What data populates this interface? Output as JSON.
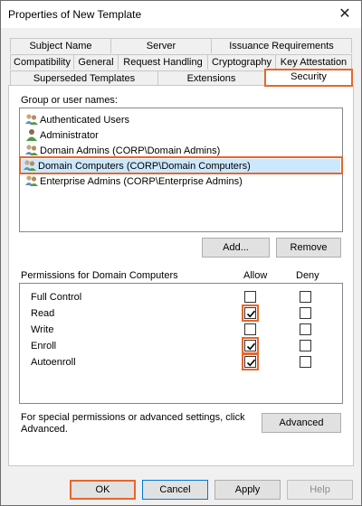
{
  "window": {
    "title": "Properties of New Template",
    "close_glyph": "✕"
  },
  "tabs": {
    "row1": [
      "Subject Name",
      "Server",
      "Issuance Requirements"
    ],
    "row2": [
      "Compatibility",
      "General",
      "Request Handling",
      "Cryptography",
      "Key Attestation"
    ],
    "row3": [
      "Superseded Templates",
      "Extensions",
      "Security"
    ],
    "active": "Security"
  },
  "security": {
    "groups_label": "Group or user names:",
    "groups": [
      {
        "name": "Authenticated Users",
        "icon": "group-icon",
        "selected": false
      },
      {
        "name": "Administrator",
        "icon": "user-icon",
        "selected": false
      },
      {
        "name": "Domain Admins (CORP\\Domain Admins)",
        "icon": "group-icon",
        "selected": false
      },
      {
        "name": "Domain Computers (CORP\\Domain Computers)",
        "icon": "group-icon",
        "selected": true
      },
      {
        "name": "Enterprise Admins (CORP\\Enterprise Admins)",
        "icon": "group-icon",
        "selected": false
      }
    ],
    "add_button": "Add...",
    "remove_button": "Remove",
    "permissions_label": "Permissions for Domain Computers",
    "allow_header": "Allow",
    "deny_header": "Deny",
    "permissions": [
      {
        "name": "Full Control",
        "allow": false,
        "deny": false
      },
      {
        "name": "Read",
        "allow": true,
        "deny": false
      },
      {
        "name": "Write",
        "allow": false,
        "deny": false
      },
      {
        "name": "Enroll",
        "allow": true,
        "deny": false
      },
      {
        "name": "Autoenroll",
        "allow": true,
        "deny": false
      }
    ],
    "advanced_text": "For special permissions or advanced settings, click Advanced.",
    "advanced_button": "Advanced"
  },
  "footer": {
    "ok": "OK",
    "cancel": "Cancel",
    "apply": "Apply",
    "help": "Help"
  },
  "colors": {
    "highlight": "#e8662a",
    "selection": "#cce8ff"
  }
}
